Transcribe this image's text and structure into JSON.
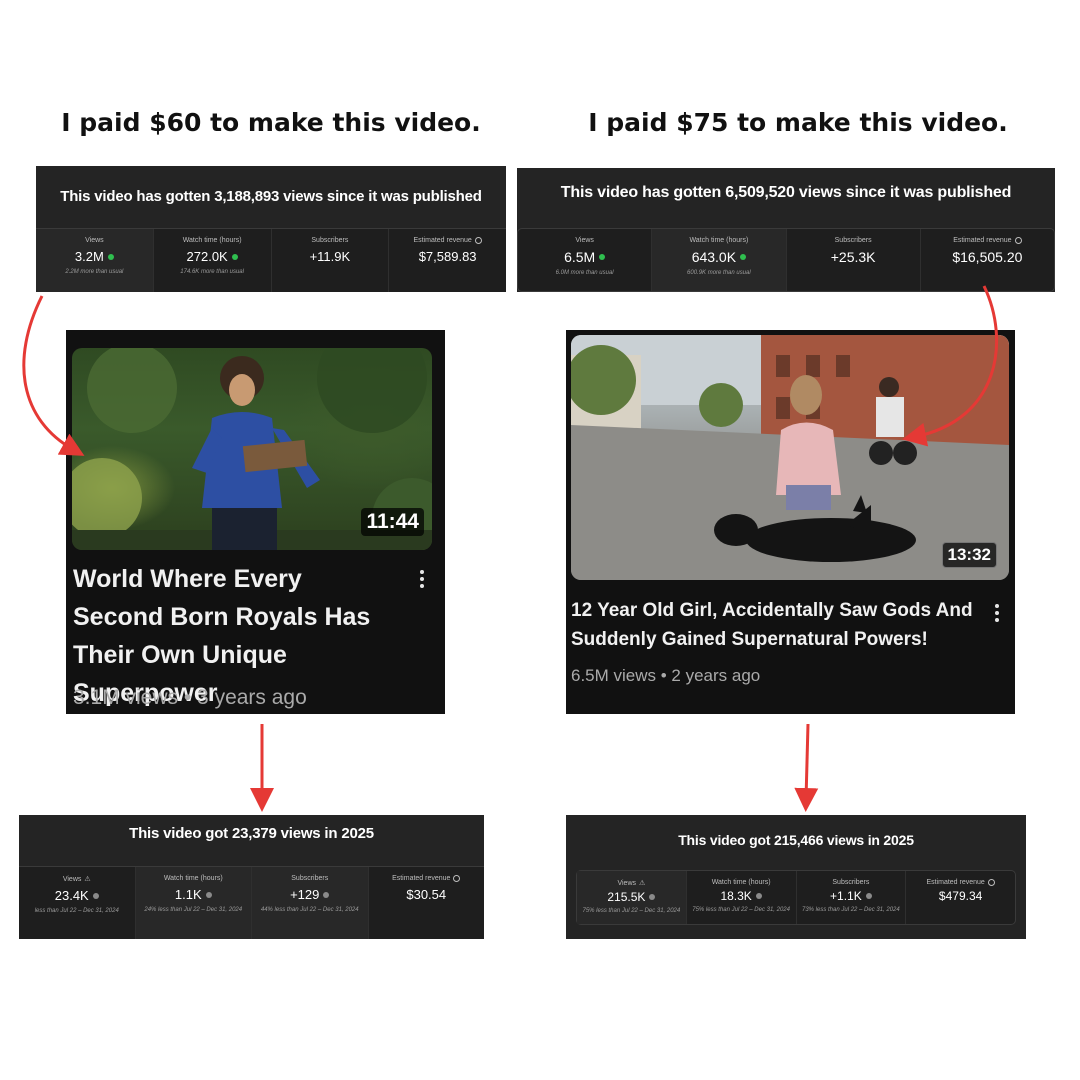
{
  "headlines": {
    "left": "I paid $60 to make this video.",
    "right": "I paid $75 to make this video."
  },
  "panels": {
    "top_left": {
      "title": "This video has gotten 3,188,893 views since it was published",
      "stats": [
        {
          "label": "Views",
          "value": "3.2M",
          "note": "2.2M more than usual"
        },
        {
          "label": "Watch time (hours)",
          "value": "272.0K",
          "note": "174.6K more than usual"
        },
        {
          "label": "Subscribers",
          "value": "+11.9K",
          "note": ""
        },
        {
          "label": "Estimated revenue",
          "value": "$7,589.83",
          "note": ""
        }
      ]
    },
    "top_right": {
      "title": "This video has gotten 6,509,520 views since it was published",
      "stats": [
        {
          "label": "Views",
          "value": "6.5M",
          "note": "6.0M more than usual"
        },
        {
          "label": "Watch time (hours)",
          "value": "643.0K",
          "note": "600.9K more than usual"
        },
        {
          "label": "Subscribers",
          "value": "+25.3K",
          "note": ""
        },
        {
          "label": "Estimated revenue",
          "value": "$16,505.20",
          "note": ""
        }
      ]
    },
    "bottom_left": {
      "title": "This video got 23,379 views in 2025",
      "stats": [
        {
          "label": "Views",
          "value": "23.4K",
          "note": "less than Jul 22 – Dec 31, 2024"
        },
        {
          "label": "Watch time (hours)",
          "value": "1.1K",
          "note": "24% less than Jul 22 – Dec 31, 2024"
        },
        {
          "label": "Subscribers",
          "value": "+129",
          "note": "44% less than Jul 22 – Dec 31, 2024"
        },
        {
          "label": "Estimated revenue",
          "value": "$30.54",
          "note": ""
        }
      ]
    },
    "bottom_right": {
      "title": "This video got 215,466 views in 2025",
      "stats": [
        {
          "label": "Views",
          "value": "215.5K",
          "note": "75% less than Jul 22 – Dec 31, 2024"
        },
        {
          "label": "Watch time (hours)",
          "value": "18.3K",
          "note": "75% less than Jul 22 – Dec 31, 2024"
        },
        {
          "label": "Subscribers",
          "value": "+1.1K",
          "note": "73% less than Jul 22 – Dec 31, 2024"
        },
        {
          "label": "Estimated revenue",
          "value": "$479.34",
          "note": ""
        }
      ]
    }
  },
  "videos": {
    "left": {
      "title": "World Where Every Second Born Royals Has Their Own Unique Superpower",
      "meta": "3.1M views • 3 years ago",
      "duration": "11:44"
    },
    "right": {
      "title": "12 Year Old Girl, Accidentally Saw Gods And Suddenly Gained Supernatural Powers!",
      "meta": "6.5M views • 2 years ago",
      "duration": "13:32"
    }
  },
  "colors": {
    "panel_bg": "#242424",
    "card_bg": "#111111",
    "arrow_red": "#e53935",
    "positive_dot": "#2fbf4f"
  }
}
